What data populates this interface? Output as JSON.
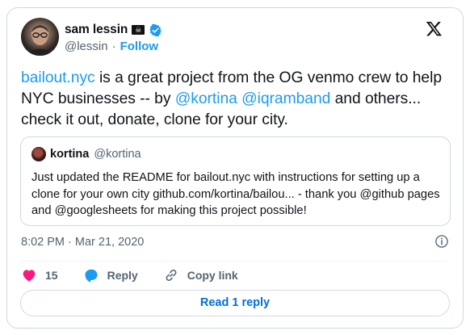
{
  "author": {
    "name": "sam lessin",
    "flag": "☠",
    "handle": "@lessin",
    "separator": "·",
    "follow_label": "Follow"
  },
  "tweet": {
    "link_site": "bailout.nyc",
    "text_1": " is a great project from the OG venmo crew to help NYC businesses -- by ",
    "mention_1": "@kortina",
    "space": " ",
    "mention_2": "@iqramband",
    "text_2": " and others...  check it out, donate, clone for your city."
  },
  "quote": {
    "name": "kortina",
    "handle": "@kortina",
    "text": "Just updated the README for bailout.nyc with instructions for setting up a clone for your own city github.com/kortina/bailou... - thank you @github pages and @googlesheets for making this project possible!"
  },
  "meta": {
    "timestamp": "8:02 PM · Mar 21, 2020"
  },
  "actions": {
    "like_count": "15",
    "reply_label": "Reply",
    "copy_label": "Copy link"
  },
  "read_replies_label": "Read 1 reply",
  "colors": {
    "accent": "#1d9bf0",
    "like": "#f91880",
    "reply_button_text": "#006fd6"
  },
  "icons": [
    "x-logo-icon",
    "verified-badge-icon",
    "info-icon",
    "heart-icon",
    "reply-bubble-icon",
    "copy-link-icon"
  ]
}
